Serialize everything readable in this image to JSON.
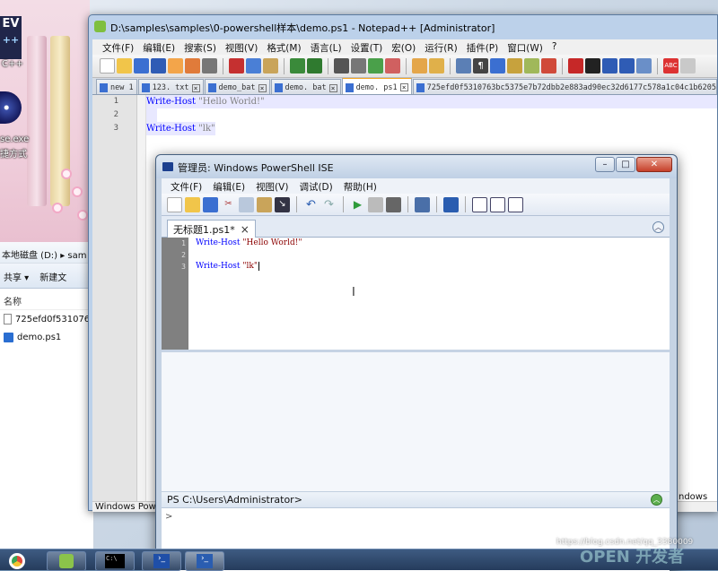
{
  "desktop": {
    "dev_logo": "EV",
    "dev_logo_sub": "++",
    "side_text_1": "C++",
    "icon_label_1": "se.exe",
    "icon_label_2": "捷方式"
  },
  "explorer": {
    "address": "本地磁盘 (D:)  ▸  sam",
    "toolbar": [
      "共享 ▾",
      "新建文"
    ],
    "column_name": "名称",
    "items": [
      "725efd0f531076",
      "demo.ps1"
    ]
  },
  "notepadpp": {
    "title": "D:\\samples\\samples\\0-powershell样本\\demo.ps1 - Notepad++ [Administrator]",
    "menu": [
      "文件(F)",
      "编辑(E)",
      "搜索(S)",
      "视图(V)",
      "格式(M)",
      "语言(L)",
      "设置(T)",
      "宏(O)",
      "运行(R)",
      "插件(P)",
      "窗口(W)",
      "?"
    ],
    "tabs": [
      "new 1",
      "123. txt",
      "demo_bat",
      "demo. bat",
      "demo. ps1",
      "725efd0f5310763bc5375e7b72dbb2e883ad90ec32d6177c578a1c04c1b62054_r"
    ],
    "active_tab": "demo. ps1",
    "line_numbers": [
      "1",
      "2",
      "3"
    ],
    "code": [
      {
        "kw": "Write-Host",
        "str": " \"Hello World!\""
      },
      {
        "kw": "",
        "str": ""
      },
      {
        "kw": "Write-Host",
        "str": " \"lk\""
      }
    ],
    "status": "Windows Powe"
  },
  "ise": {
    "title": "管理员: Windows PowerShell ISE",
    "menu": [
      "文件(F)",
      "编辑(E)",
      "视图(V)",
      "调试(D)",
      "帮助(H)"
    ],
    "tab_label": "无标题1.ps1*",
    "tab_close": "×",
    "collapse_glyph": "︿",
    "line_numbers": [
      "1",
      "2",
      "3"
    ],
    "code": [
      {
        "kw": "Write-Host",
        "str": " \"Hello World!\""
      },
      {
        "kw": "",
        "str": ""
      },
      {
        "kw": "Write-Host",
        "str": " \"lk\""
      }
    ],
    "cmd_path": "PS C:\\Users\\Administrator>",
    "cmd_prompt": ">"
  },
  "right_edge_label": "ndows",
  "watermark": "https://blog.csdn.net/qq_3380009",
  "taskbar": {
    "cmd_label": "C:\\",
    "brand_text": "OPEN 开发者"
  }
}
